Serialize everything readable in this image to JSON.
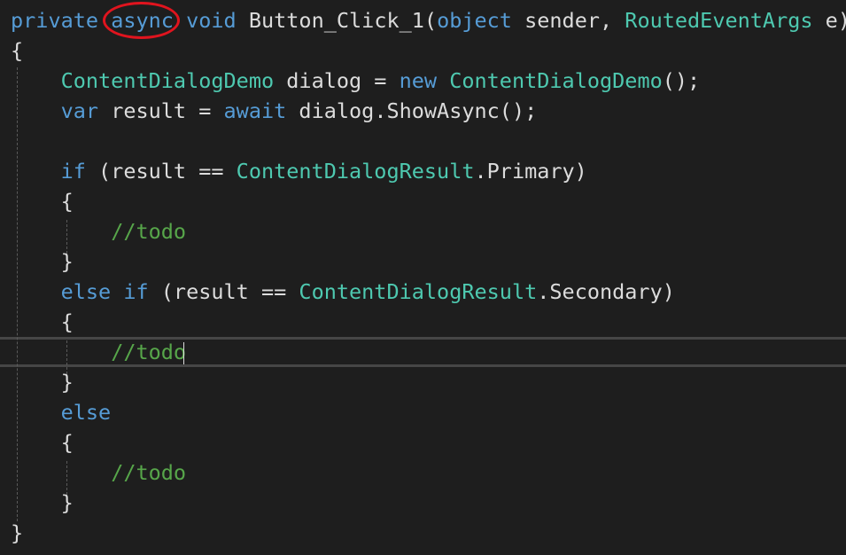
{
  "editor": {
    "lines": [
      [
        {
          "t": "private ",
          "c": "kw"
        },
        {
          "t": "async",
          "c": "kw"
        },
        {
          "t": " ",
          "c": "plain"
        },
        {
          "t": "void",
          "c": "kw"
        },
        {
          "t": " Button_Click_1(",
          "c": "plain"
        },
        {
          "t": "object",
          "c": "kw"
        },
        {
          "t": " sender, ",
          "c": "plain"
        },
        {
          "t": "RoutedEventArgs",
          "c": "type"
        },
        {
          "t": " e)",
          "c": "plain"
        }
      ],
      [
        {
          "t": "{",
          "c": "plain"
        }
      ],
      [
        {
          "t": "    ",
          "c": "plain"
        },
        {
          "t": "ContentDialogDemo",
          "c": "type"
        },
        {
          "t": " dialog = ",
          "c": "plain"
        },
        {
          "t": "new",
          "c": "kw"
        },
        {
          "t": " ",
          "c": "plain"
        },
        {
          "t": "ContentDialogDemo",
          "c": "type"
        },
        {
          "t": "();",
          "c": "plain"
        }
      ],
      [
        {
          "t": "    ",
          "c": "plain"
        },
        {
          "t": "var",
          "c": "kw"
        },
        {
          "t": " result = ",
          "c": "plain"
        },
        {
          "t": "await",
          "c": "kw"
        },
        {
          "t": " dialog.ShowAsync();",
          "c": "plain"
        }
      ],
      [],
      [
        {
          "t": "    ",
          "c": "plain"
        },
        {
          "t": "if",
          "c": "kw"
        },
        {
          "t": " (result == ",
          "c": "plain"
        },
        {
          "t": "ContentDialogResult",
          "c": "type"
        },
        {
          "t": ".Primary)",
          "c": "plain"
        }
      ],
      [
        {
          "t": "    {",
          "c": "plain"
        }
      ],
      [
        {
          "t": "        ",
          "c": "plain"
        },
        {
          "t": "//todo",
          "c": "cmt"
        }
      ],
      [
        {
          "t": "    }",
          "c": "plain"
        }
      ],
      [
        {
          "t": "    ",
          "c": "plain"
        },
        {
          "t": "else",
          "c": "kw"
        },
        {
          "t": " ",
          "c": "plain"
        },
        {
          "t": "if",
          "c": "kw"
        },
        {
          "t": " (result == ",
          "c": "plain"
        },
        {
          "t": "ContentDialogResult",
          "c": "type"
        },
        {
          "t": ".Secondary)",
          "c": "plain"
        }
      ],
      [
        {
          "t": "    {",
          "c": "plain"
        }
      ],
      [
        {
          "t": "        ",
          "c": "plain"
        },
        {
          "t": "//todo",
          "c": "cmt"
        }
      ],
      [
        {
          "t": "    }",
          "c": "plain"
        }
      ],
      [
        {
          "t": "    ",
          "c": "plain"
        },
        {
          "t": "else",
          "c": "kw"
        }
      ],
      [
        {
          "t": "    {",
          "c": "plain"
        }
      ],
      [
        {
          "t": "        ",
          "c": "plain"
        },
        {
          "t": "//todo",
          "c": "cmt"
        }
      ],
      [
        {
          "t": "    }",
          "c": "plain"
        }
      ],
      [
        {
          "t": "}",
          "c": "plain"
        }
      ]
    ],
    "current_line": 12,
    "highlighted_token": "async"
  },
  "colors": {
    "background": "#1e1e1e",
    "keyword": "#569cd6",
    "type": "#4ec9b0",
    "comment": "#57a64a",
    "text": "#dcdcdc",
    "annotation": "#e0141e"
  }
}
